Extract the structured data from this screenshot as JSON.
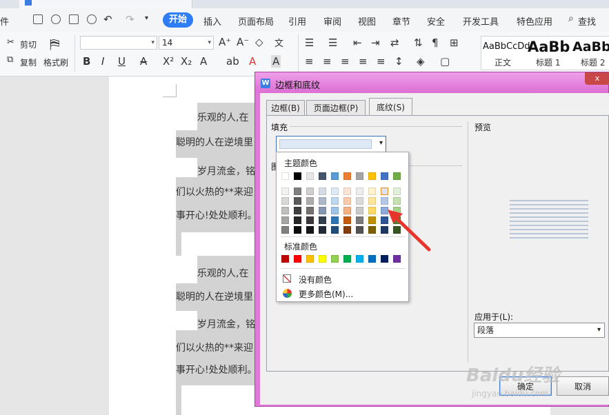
{
  "quick_access": {
    "file_menu_fragment": "件"
  },
  "ribbon_tabs": [
    "开始",
    "插入",
    "页面布局",
    "引用",
    "审阅",
    "视图",
    "章节",
    "安全",
    "开发工具",
    "特色应用"
  ],
  "search_label": "查找",
  "clipboard": {
    "cut": "剪切",
    "copy": "复制",
    "format_painter": "格式刷"
  },
  "font": {
    "size_value": "14"
  },
  "styles": [
    {
      "preview": "AaBbCcDd",
      "name": "正文"
    },
    {
      "preview": "AaBb",
      "name": "标题 1"
    },
    {
      "preview": "AaBb",
      "name": "标题 2"
    }
  ],
  "document": {
    "lines": [
      "乐观的人,在",
      "聪明的人在逆境里",
      "岁月流金，铭",
      "们以火热的**来迎",
      "事开心!处处顺利。",
      "乐观的人,在",
      "聪明的人在逆境里",
      "岁月流金，铭",
      "们以火热的**来迎",
      "事开心!处处顺利。"
    ]
  },
  "dialog": {
    "title": "边框和底纹",
    "app_icon": "W",
    "close_label": "x",
    "tabs": [
      "边框(B)",
      "页面边框(P)",
      "底纹(S)"
    ],
    "active_tab": 2,
    "fill_label": "填充",
    "pattern_fragment": "图",
    "preview_label": "预览",
    "apply_to_label": "应用于(L):",
    "apply_to_value": "段落",
    "ok_label": "确定",
    "cancel_label": "取消"
  },
  "color_popup": {
    "theme_label": "主题颜色",
    "standard_label": "标准颜色",
    "no_color_label": "没有颜色",
    "more_colors_label": "更多颜色(M)...",
    "theme_row": [
      "#ffffff",
      "#000000",
      "#e7e6e6",
      "#44546a",
      "#5b9bd5",
      "#ed7d31",
      "#a5a5a5",
      "#ffc000",
      "#4472c4",
      "#70ad47"
    ],
    "shade_rows": [
      [
        "#f2f2f2",
        "#7f7f7f",
        "#d0cece",
        "#d6dce4",
        "#deebf6",
        "#fbe5d5",
        "#ededed",
        "#fff2cc",
        "#dae3f3",
        "#e2efd9"
      ],
      [
        "#d8d8d8",
        "#595959",
        "#aeabab",
        "#adb9ca",
        "#bdd7ee",
        "#f7cbac",
        "#dbdbdb",
        "#fee599",
        "#b4c7e7",
        "#c5e0b3"
      ],
      [
        "#bfbfbf",
        "#3f3f3f",
        "#757070",
        "#8496b0",
        "#9dc3e6",
        "#f4b183",
        "#c9c9c9",
        "#ffd965",
        "#8eaadb",
        "#a8d08d"
      ],
      [
        "#a5a5a5",
        "#262626",
        "#3a3838",
        "#323f4f",
        "#2e75b5",
        "#c55a11",
        "#7b7b7b",
        "#bf9000",
        "#2f5496",
        "#538135"
      ],
      [
        "#7f7f7f",
        "#0c0c0c",
        "#171616",
        "#222a35",
        "#1e4e79",
        "#843c0b",
        "#525252",
        "#7f6000",
        "#203864",
        "#375623"
      ]
    ],
    "selected": [
      0,
      8
    ],
    "standard_row": [
      "#c00000",
      "#ff0000",
      "#ffc000",
      "#ffff00",
      "#92d050",
      "#00b050",
      "#00b0f0",
      "#0070c0",
      "#002060",
      "#7030a0"
    ]
  },
  "watermark": {
    "text": "Baidu经验",
    "sub": "jingyan.baidu.com"
  },
  "colors": {
    "accent": "#2e7cf6",
    "dialog_frame": "#e07ad8",
    "arrow": "#e8352b"
  }
}
